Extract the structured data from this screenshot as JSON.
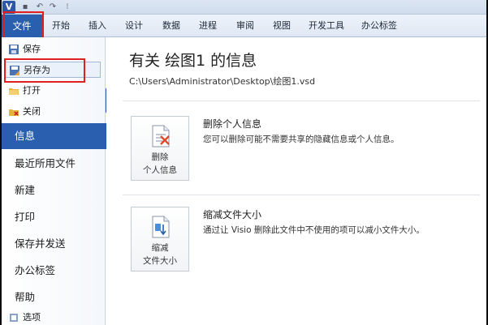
{
  "qat": {
    "app_letter": "V",
    "save_glyph": "▪",
    "undo_glyph": "↶",
    "redo_glyph": "↷",
    "more_glyph": "⁝"
  },
  "tabs": [
    "文件",
    "开始",
    "插入",
    "设计",
    "数据",
    "进程",
    "审阅",
    "视图",
    "开发工具",
    "办公标签"
  ],
  "nav": {
    "commands": [
      "保存",
      "另存为",
      "打开",
      "关闭"
    ],
    "items": [
      "信息",
      "最近所用文件",
      "新建",
      "打印",
      "保存并发送",
      "办公标签",
      "帮助"
    ],
    "options": "选项"
  },
  "main": {
    "title": "有关 绘图1 的信息",
    "path": "C:\\Users\\Administrator\\Desktop\\绘图1.vsd",
    "sections": [
      {
        "button_line1": "删除",
        "button_line2": "个人信息",
        "title": "删除个人信息",
        "desc": "您可以删除可能不需要共享的隐藏信息或个人信息。"
      },
      {
        "button_line1": "缩减",
        "button_line2": "文件大小",
        "title": "缩减文件大小",
        "desc": "通过让 Visio 删除此文件中不使用的项可以减小文件大小。"
      }
    ]
  },
  "colors": {
    "accent": "#2a5fb0",
    "highlight_box": "#e02020"
  }
}
